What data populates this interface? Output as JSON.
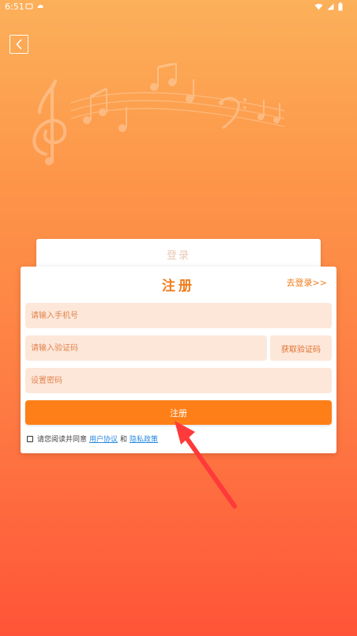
{
  "status_bar": {
    "time": "6:51"
  },
  "icons": {
    "back": "chevron-left-icon",
    "music": "music-notes-icon",
    "wifi": "wifi-icon",
    "signal": "signal-icon",
    "battery": "battery-icon"
  },
  "colors": {
    "accent": "#fe7f17",
    "title": "#ef7c1a",
    "input_bg": "#fde7d9",
    "link": "#2a8ae0",
    "arrow": "#ff3a3a"
  },
  "login_card": {
    "label": "登录"
  },
  "register_card": {
    "title": "注册",
    "goto_login": "去登录>>",
    "phone_placeholder": "请输入手机号",
    "code_placeholder": "请输入验证码",
    "get_code_label": "获取验证码",
    "password_placeholder": "设置密码",
    "submit_label": "注册",
    "agree_text": "请您阅读并同意",
    "user_agreement": "用户协议",
    "and_text": "和",
    "privacy_policy": "隐私政策"
  }
}
